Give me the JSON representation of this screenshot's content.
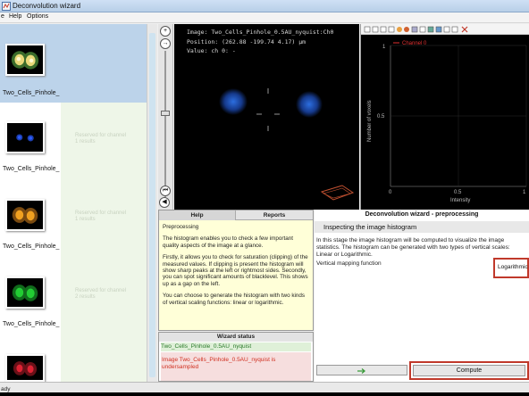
{
  "window": {
    "title": "Deconvolution wizard"
  },
  "menu": {
    "items": [
      "e",
      "Help",
      "Options"
    ]
  },
  "thumbnails": [
    {
      "label": "Two_Cells_Pinhole_",
      "channel_color": "#e8d878",
      "reserved": ""
    },
    {
      "label": "Two_Cells_Pinhole_",
      "channel_color": "#2b5cff",
      "reserved": "Reserved for channel 1 results"
    },
    {
      "label": "Two_Cells_Pinhole_",
      "channel_color": "#f0a020",
      "reserved": "Reserved for channel 1 results"
    },
    {
      "label": "Two_Cells_Pinhole_",
      "channel_color": "#22cc33",
      "reserved": "Reserved for channel 2 results"
    },
    {
      "label": "Two_Cells_Pinhole_",
      "channel_color": "#dd2233",
      "reserved": ""
    }
  ],
  "viewer": {
    "image_line": "Image: Two_Cells_Pinhole_0.5AU_nyquist:Ch0",
    "position_line": "Position: (262.88 -199.74 4.17) μm",
    "value_line": "Value: ch 0: -",
    "tools": [
      "+",
      "→",
      "⏮",
      "◀",
      "▶"
    ]
  },
  "histogram": {
    "legend": "Channel 0",
    "xlabel": "Intensity",
    "ylabel": "Number of voxels",
    "yticks": [
      "1",
      "0.5"
    ],
    "xticks": [
      "0",
      "0.5",
      "1"
    ],
    "series_color": "#e03030"
  },
  "help": {
    "tabs": [
      "Help",
      "Reports"
    ],
    "title": "Preprocessing",
    "paragraphs": [
      "The histogram enables you to check a few important quality aspects of the image at a glance.",
      "Firstly, it allows you to check for saturation (clipping) of the measured values. If clipping is present the histogram will show sharp peaks at the left or rightmost sides. Secondly, you can spot significant amounts of blacklevel. This shows up as a gap on the left.",
      "You can choose to generate the histogram with two kinds of vertical scaling functions: linear or logarithmic."
    ]
  },
  "status": {
    "header": "Wizard status",
    "ok_text": "Two_Cells_Pinhole_0.5AU_nyquist",
    "warn_text": "Image Two_Cells_Pinhole_0.5AU_nyquist is undersampled"
  },
  "wizard": {
    "title": "Deconvolution wizard - preprocessing",
    "subtitle": "Inspecting the image histogram",
    "description": "In this stage the image histogram will be computed to visualize the image statistics. The histogram can be generated with two types of vertical scales: Linear or Logarithmic.",
    "mapping_label": "Vertical mapping function",
    "mapping_value": "Logarithmic",
    "compute_label": "Compute"
  },
  "statusbar": {
    "text": "ady"
  }
}
